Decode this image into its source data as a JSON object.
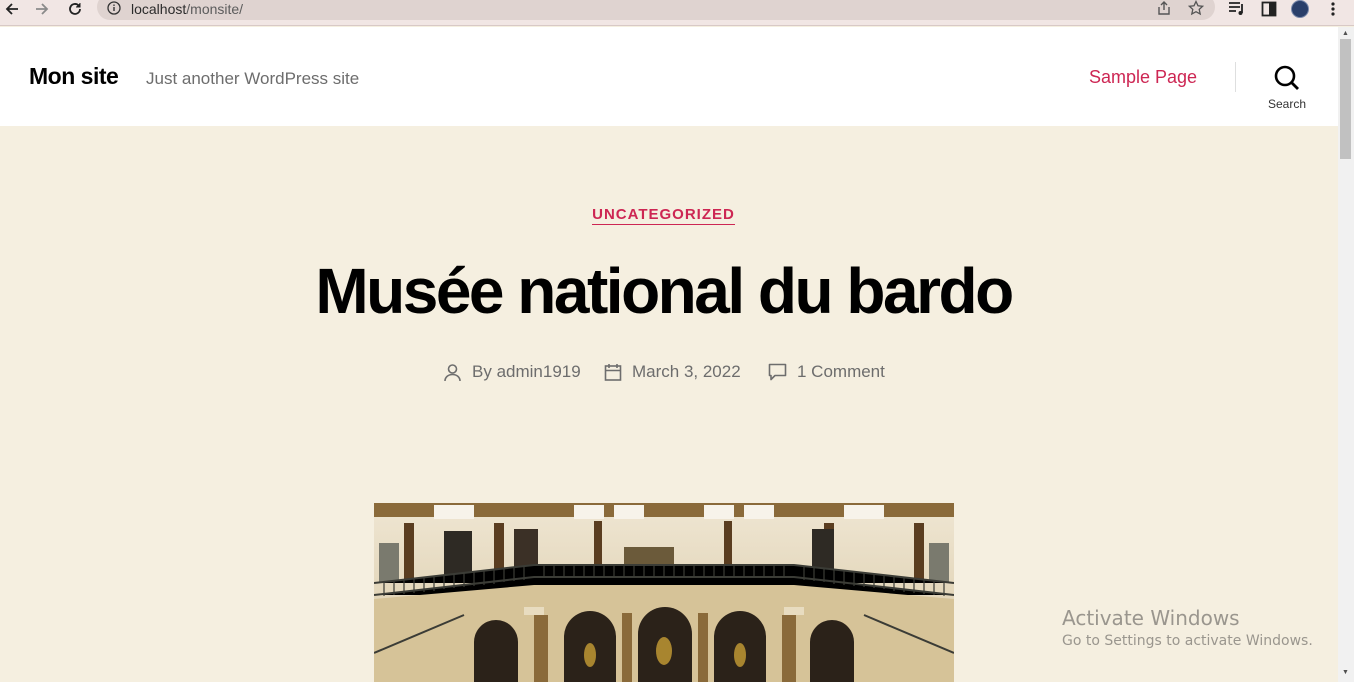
{
  "browser": {
    "url_host": "localhost",
    "url_path": "/monsite/"
  },
  "header": {
    "site_title": "Mon site",
    "site_description": "Just another WordPress site",
    "nav_link": "Sample Page",
    "search_label": "Search"
  },
  "post": {
    "category": "UNCATEGORIZED",
    "title": "Musée national du bardo",
    "author_prefix": "By",
    "author": "admin1919",
    "date": "March 3, 2022",
    "comments": "1 Comment"
  },
  "watermark": {
    "title": "Activate Windows",
    "subtitle": "Go to Settings to activate Windows."
  },
  "colors": {
    "accent": "#cd2653",
    "page_background": "#f5efe0",
    "header_background": "#ffffff"
  }
}
